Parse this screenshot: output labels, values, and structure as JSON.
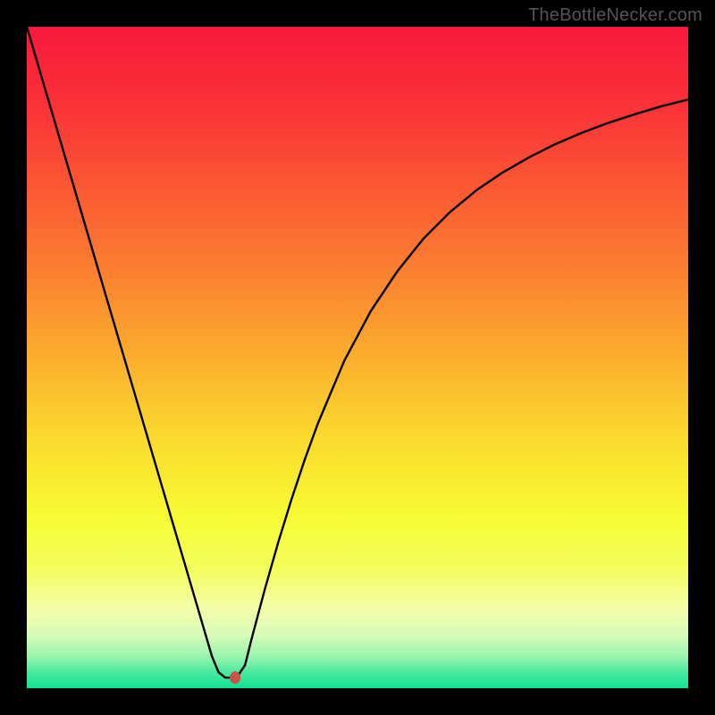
{
  "watermark": "TheBottleNecker.com",
  "colors": {
    "frame": "#000000",
    "curve": "#000000",
    "marker": "#c9534a"
  },
  "chart_data": {
    "type": "line",
    "title": "",
    "xlabel": "",
    "ylabel": "",
    "xlim": [
      0,
      100
    ],
    "ylim": [
      0,
      100
    ],
    "gradient_stops": [
      {
        "offset": 0.0,
        "color": "#f8193b"
      },
      {
        "offset": 0.12,
        "color": "#fa3237"
      },
      {
        "offset": 0.25,
        "color": "#fb5a32"
      },
      {
        "offset": 0.38,
        "color": "#fb8330"
      },
      {
        "offset": 0.5,
        "color": "#fbae2d"
      },
      {
        "offset": 0.62,
        "color": "#fbd92d"
      },
      {
        "offset": 0.74,
        "color": "#f7fb33"
      },
      {
        "offset": 0.82,
        "color": "#f4fd5c"
      },
      {
        "offset": 0.88,
        "color": "#f3feaa"
      },
      {
        "offset": 0.92,
        "color": "#d6fcb8"
      },
      {
        "offset": 0.955,
        "color": "#93f4ad"
      },
      {
        "offset": 0.975,
        "color": "#4ae99f"
      },
      {
        "offset": 1.0,
        "color": "#14e294"
      }
    ],
    "x": [
      0,
      2,
      4,
      6,
      8,
      10,
      12,
      14,
      16,
      18,
      20,
      22,
      24,
      26,
      28,
      29,
      30,
      31,
      32,
      33,
      34,
      36,
      38,
      40,
      42,
      44,
      48,
      52,
      56,
      60,
      64,
      68,
      72,
      76,
      80,
      84,
      88,
      92,
      96,
      100
    ],
    "values": [
      100,
      93.2,
      86.4,
      79.6,
      72.8,
      66.0,
      59.2,
      52.4,
      45.6,
      38.8,
      32.0,
      25.2,
      18.4,
      11.6,
      4.8,
      2.4,
      1.6,
      1.6,
      2.0,
      3.5,
      7.5,
      15.0,
      22.0,
      28.5,
      34.5,
      40.0,
      49.5,
      57.0,
      63.0,
      68.0,
      72.0,
      75.3,
      78.0,
      80.3,
      82.3,
      84.0,
      85.5,
      86.8,
      88.0,
      89.0
    ],
    "marker": {
      "x": 31.5,
      "y": 1.6
    }
  }
}
